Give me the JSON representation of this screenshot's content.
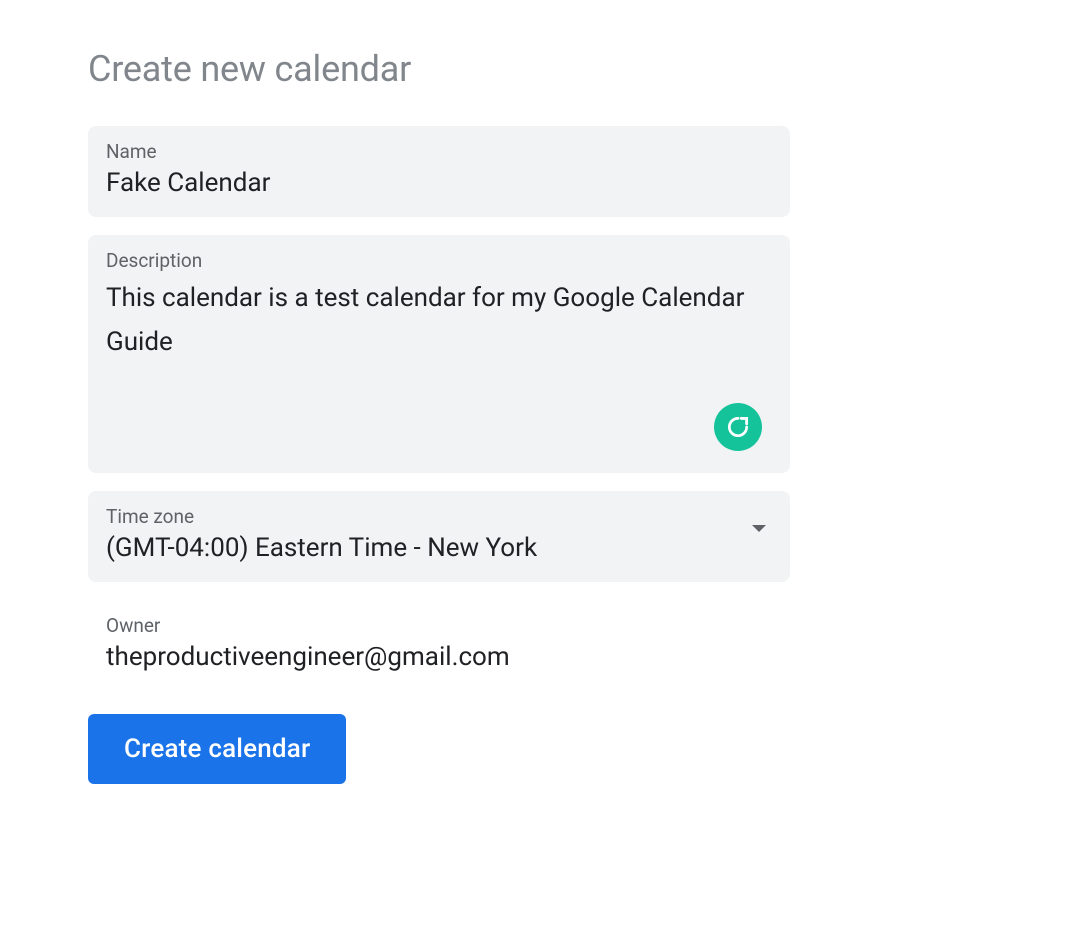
{
  "page": {
    "title": "Create new calendar"
  },
  "form": {
    "name": {
      "label": "Name",
      "value": "Fake Calendar"
    },
    "description": {
      "label": "Description",
      "value": "This calendar is a test calendar for my Google Calendar Guide"
    },
    "timezone": {
      "label": "Time zone",
      "value": "(GMT-04:00) Eastern Time - New York"
    },
    "owner": {
      "label": "Owner",
      "value": "theproductiveengineer@gmail.com"
    }
  },
  "actions": {
    "create_label": "Create calendar"
  },
  "icons": {
    "grammarly": "grammarly-badge"
  }
}
